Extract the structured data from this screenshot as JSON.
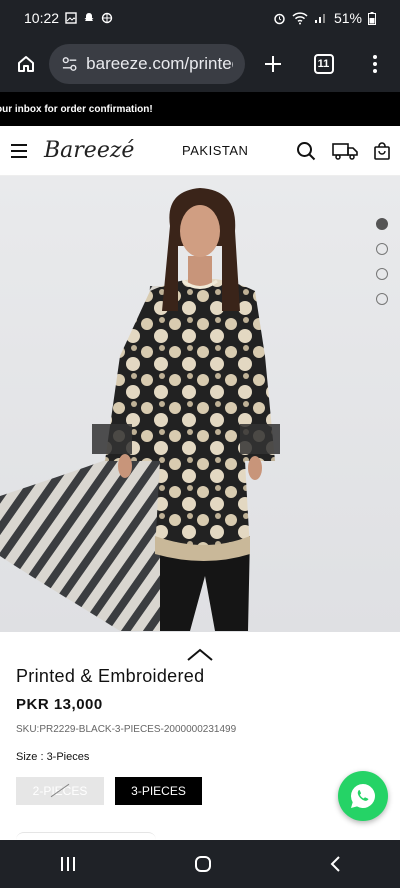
{
  "status": {
    "time": "10:22",
    "battery": "51%"
  },
  "browser": {
    "url": "bareeze.com/printec",
    "tab_count": "11"
  },
  "announcement": "our inbox for order confirmation!",
  "header": {
    "logo": "Bareezé",
    "country": "PAKISTAN"
  },
  "gallery": {
    "slides": 4,
    "active_slide": 1
  },
  "product": {
    "title": "Printed & Embroidered",
    "price": "PKR 13,000",
    "sku": "SKU:PR2229-BLACK-3-PIECES-2000000231499",
    "size_label": "Size : 3-Pieces",
    "sizes": [
      "2-PIECES",
      "3-PIECES"
    ],
    "selected_size": "3-PIECES"
  },
  "colors": {
    "dark_bar": "#1f2227",
    "black": "#000000",
    "whatsapp": "#25d366"
  }
}
